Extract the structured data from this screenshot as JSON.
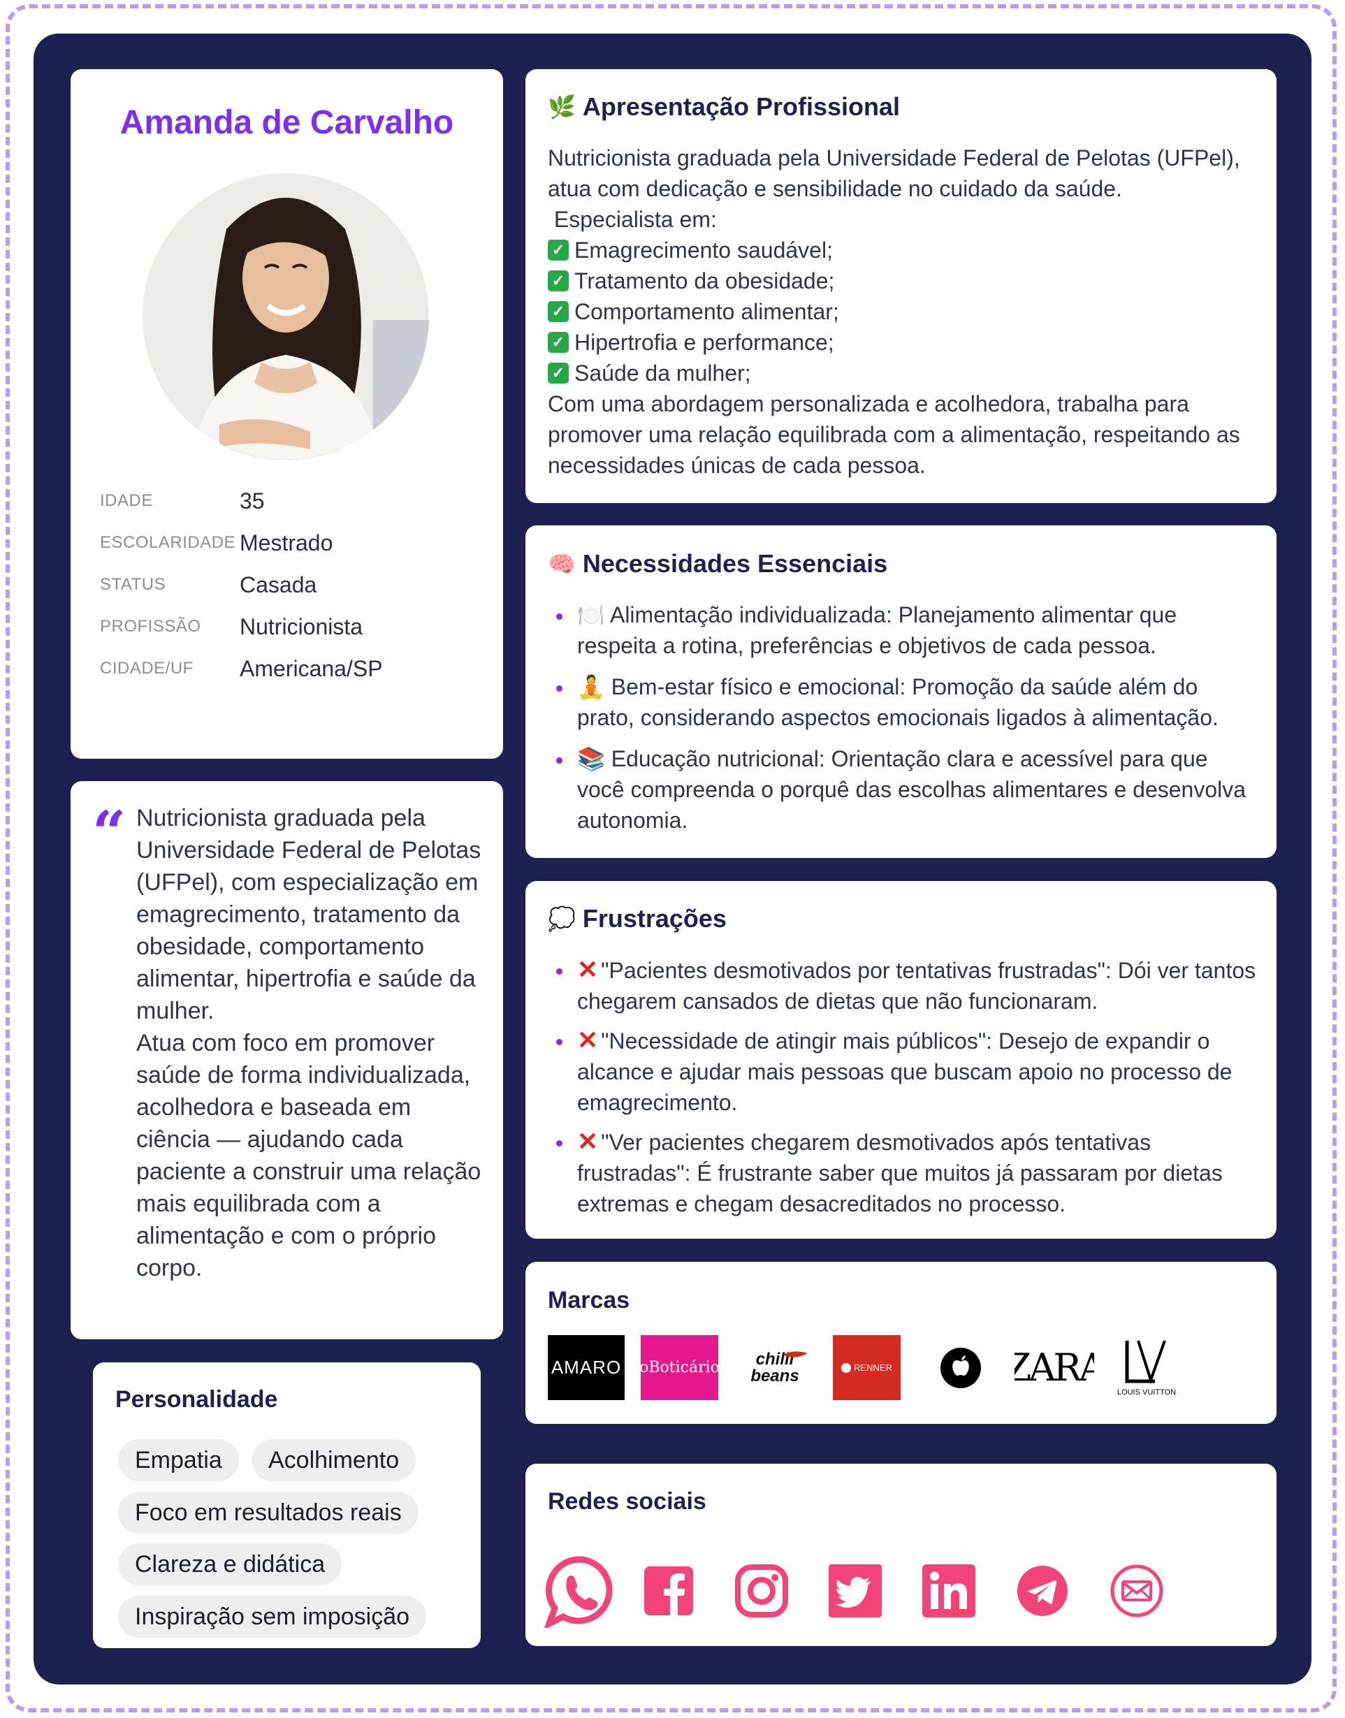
{
  "profile": {
    "name": "Amanda de Carvalho",
    "info": [
      {
        "label": "IDADE",
        "value": "35"
      },
      {
        "label": "ESCOLARIDADE",
        "value": "Mestrado"
      },
      {
        "label": "STATUS",
        "value": "Casada"
      },
      {
        "label": "PROFISSÃO",
        "value": "Nutricionista"
      },
      {
        "label": "CIDADE/UF",
        "value": "Americana/SP"
      }
    ]
  },
  "quote": {
    "text": "Nutricionista graduada pela Universidade Federal de Pelotas (UFPel), com especialização em emagrecimento, tratamento da obesidade, comportamento alimentar, hipertrofia e saúde da mulher.\n Atua com foco em promover saúde de forma individualizada, acolhedora e baseada em ciência — ajudando cada paciente a construir uma relação mais equilibrada com a alimentação e com o próprio corpo."
  },
  "personality": {
    "title": "Personalidade",
    "tags": [
      "Empatia",
      "Acolhimento",
      "Foco em resultados reais",
      "Clareza e didática",
      "Inspiração sem imposição"
    ]
  },
  "presentation": {
    "icon": "🌿",
    "title": "Apresentação Profissional",
    "intro": "Nutricionista graduada pela Universidade Federal de Pelotas (UFPel), atua com dedicação e sensibilidade no cuidado da saúde.",
    "specialist_label": " Especialista em:",
    "items": [
      "Emagrecimento saudável;",
      "Tratamento da obesidade;",
      "Comportamento alimentar;",
      "Hipertrofia e performance;",
      "Saúde da mulher;"
    ],
    "outro": "Com uma abordagem personalizada e acolhedora, trabalha para promover uma relação equilibrada com a alimentação, respeitando as necessidades únicas de cada pessoa."
  },
  "needs": {
    "icon": "🧠",
    "title": "Necessidades Essenciais",
    "items": [
      {
        "icon": "🍽️",
        "text": "Alimentação individualizada: Planejamento alimentar que respeita a rotina, preferências e objetivos de cada pessoa."
      },
      {
        "icon": "🧘",
        "text": "Bem-estar físico e emocional: Promoção da saúde além do prato, considerando aspectos emocionais ligados à alimentação."
      },
      {
        "icon": "📚",
        "text": "Educação nutricional: Orientação clara e acessível para que você compreenda o porquê das escolhas alimentares e desenvolva autonomia."
      }
    ]
  },
  "frustrations": {
    "icon": "💭",
    "title": "Frustrações",
    "items": [
      "\"Pacientes desmotivados por tentativas frustradas\": Dói ver tantos chegarem cansados de dietas que não funcionaram.",
      "\"Necessidade de atingir mais públicos\": Desejo de expandir o alcance e ajudar mais pessoas que buscam apoio no processo de emagrecimento.",
      "\"Ver pacientes chegarem desmotivados após tentativas frustradas\": É frustrante saber que muitos já passaram por dietas extremas e chegam desacreditados no processo."
    ]
  },
  "brands": {
    "title": "Marcas",
    "items": [
      {
        "name": "amaro",
        "text": "AMARO",
        "bg": "#000000",
        "fg": "#ffffff"
      },
      {
        "name": "oboticario",
        "text": "oBoticário",
        "bg": "#e4188c",
        "fg": "#ffffff"
      },
      {
        "name": "chilli-beans",
        "text": "chilli beans",
        "bg": "#ffffff",
        "fg": "#111111"
      },
      {
        "name": "renner",
        "text": "RENNER",
        "bg": "#d42a20",
        "fg": "#ffffff"
      },
      {
        "name": "apple",
        "text": "",
        "bg": "#ffffff",
        "fg": "#000000"
      },
      {
        "name": "zara",
        "text": "ZARA",
        "bg": "#ffffff",
        "fg": "#000000"
      },
      {
        "name": "louis-vuitton",
        "text": "LOUIS VUITTON",
        "bg": "#ffffff",
        "fg": "#000000"
      }
    ]
  },
  "social": {
    "title": "Redes sociais",
    "color": "#f2447a",
    "icons": [
      "whatsapp-icon",
      "facebook-icon",
      "instagram-icon",
      "twitter-icon",
      "linkedin-icon",
      "telegram-icon",
      "email-icon"
    ]
  }
}
